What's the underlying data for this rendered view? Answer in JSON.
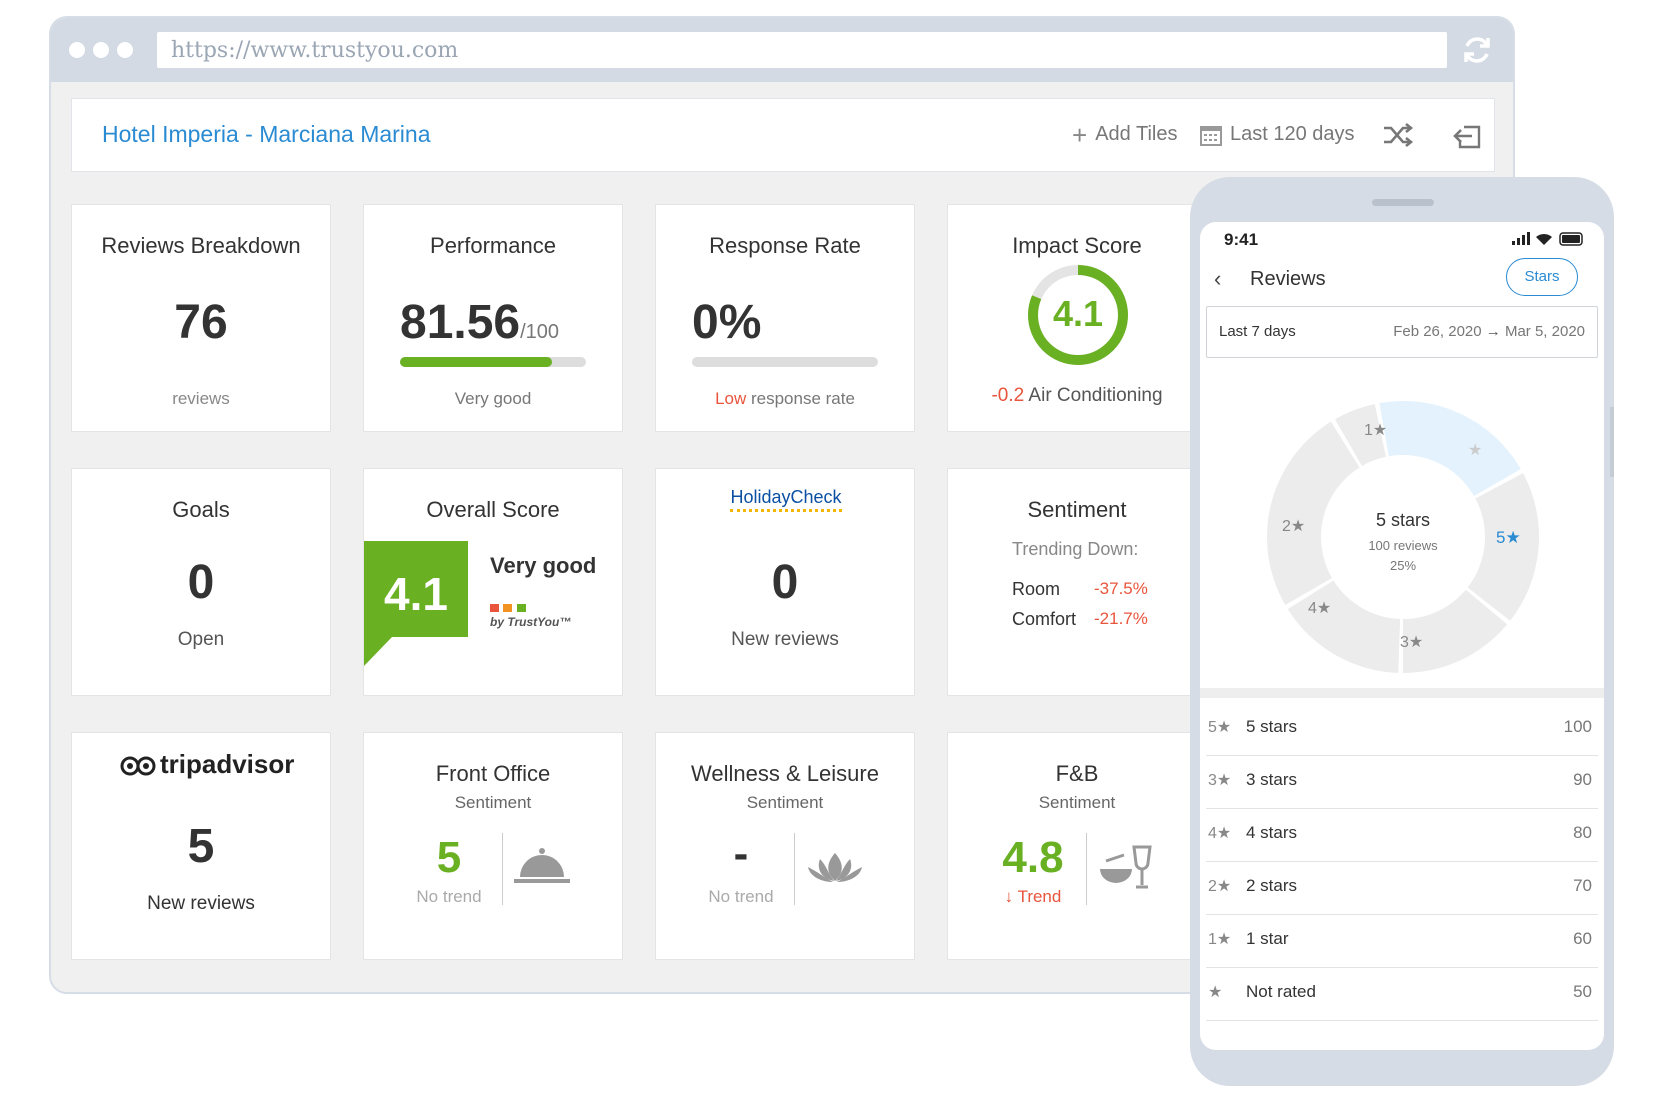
{
  "browser": {
    "url": "https://www.trustyou.com"
  },
  "header": {
    "hotel_name": "Hotel Imperia - Marciana Marina",
    "add_tiles": "Add Tiles",
    "date_range": "Last 120 days"
  },
  "tiles": {
    "reviews_breakdown": {
      "title": "Reviews Breakdown",
      "value": "76",
      "sub": "reviews"
    },
    "performance": {
      "title": "Performance",
      "value": "81.56",
      "denominator": "/100",
      "progress": 0.8156,
      "sub": "Very good"
    },
    "response_rate": {
      "title": "Response Rate",
      "value": "0%",
      "progress": 0,
      "sub_highlight": "Low",
      "sub": "response rate"
    },
    "impact_score": {
      "title": "Impact Score",
      "value": "4.1",
      "change": "-0.2",
      "category": "Air Conditioning"
    },
    "goals": {
      "title": "Goals",
      "value": "0",
      "sub": "Open"
    },
    "overall_score": {
      "title": "Overall Score",
      "value": "4.1",
      "rating": "Very good",
      "brand": "by TrustYou™"
    },
    "holidaycheck": {
      "logo": "HolidayCheck",
      "value": "0",
      "sub": "New reviews"
    },
    "sentiment": {
      "title": "Sentiment",
      "trending": "Trending Down:",
      "items": [
        {
          "label": "Room",
          "value": "-37.5%"
        },
        {
          "label": "Comfort",
          "value": "-21.7%"
        }
      ]
    },
    "tripadvisor": {
      "logo": "tripadvisor",
      "value": "5",
      "sub": "New reviews"
    },
    "front_office": {
      "title": "Front Office",
      "sub": "Sentiment",
      "value": "5",
      "trend": "No trend"
    },
    "wellness": {
      "title": "Wellness & Leisure",
      "sub": "Sentiment",
      "value": "-",
      "trend": "No trend"
    },
    "fnb": {
      "title": "F&B",
      "sub": "Sentiment",
      "value": "4.8",
      "trend": "Trend"
    }
  },
  "phone": {
    "time": "9:41",
    "title": "Reviews",
    "stars_button": "Stars",
    "period": "Last 7 days",
    "date_from": "Feb 26, 2020",
    "date_to": "Mar 5, 2020",
    "donut": {
      "center_title": "5 stars",
      "center_reviews": "100 reviews",
      "center_pct": "25%",
      "segments": [
        "1★",
        "★",
        "5★",
        "3★",
        "4★",
        "2★"
      ]
    },
    "rows": [
      {
        "stars": "5★",
        "label": "5 stars",
        "count": "100"
      },
      {
        "stars": "3★",
        "label": "3 stars",
        "count": "90"
      },
      {
        "stars": "4★",
        "label": "4 stars",
        "count": "80"
      },
      {
        "stars": "2★",
        "label": "2 stars",
        "count": "70"
      },
      {
        "stars": "1★",
        "label": "1 star",
        "count": "60"
      },
      {
        "stars": "★",
        "label": "Not rated",
        "count": "50"
      }
    ]
  },
  "colors": {
    "accent_blue": "#2a8bd3",
    "green": "#6ab023",
    "red": "#e8543c",
    "donut_grey": "#ececec",
    "donut_highlight": "#e3f2fc"
  }
}
